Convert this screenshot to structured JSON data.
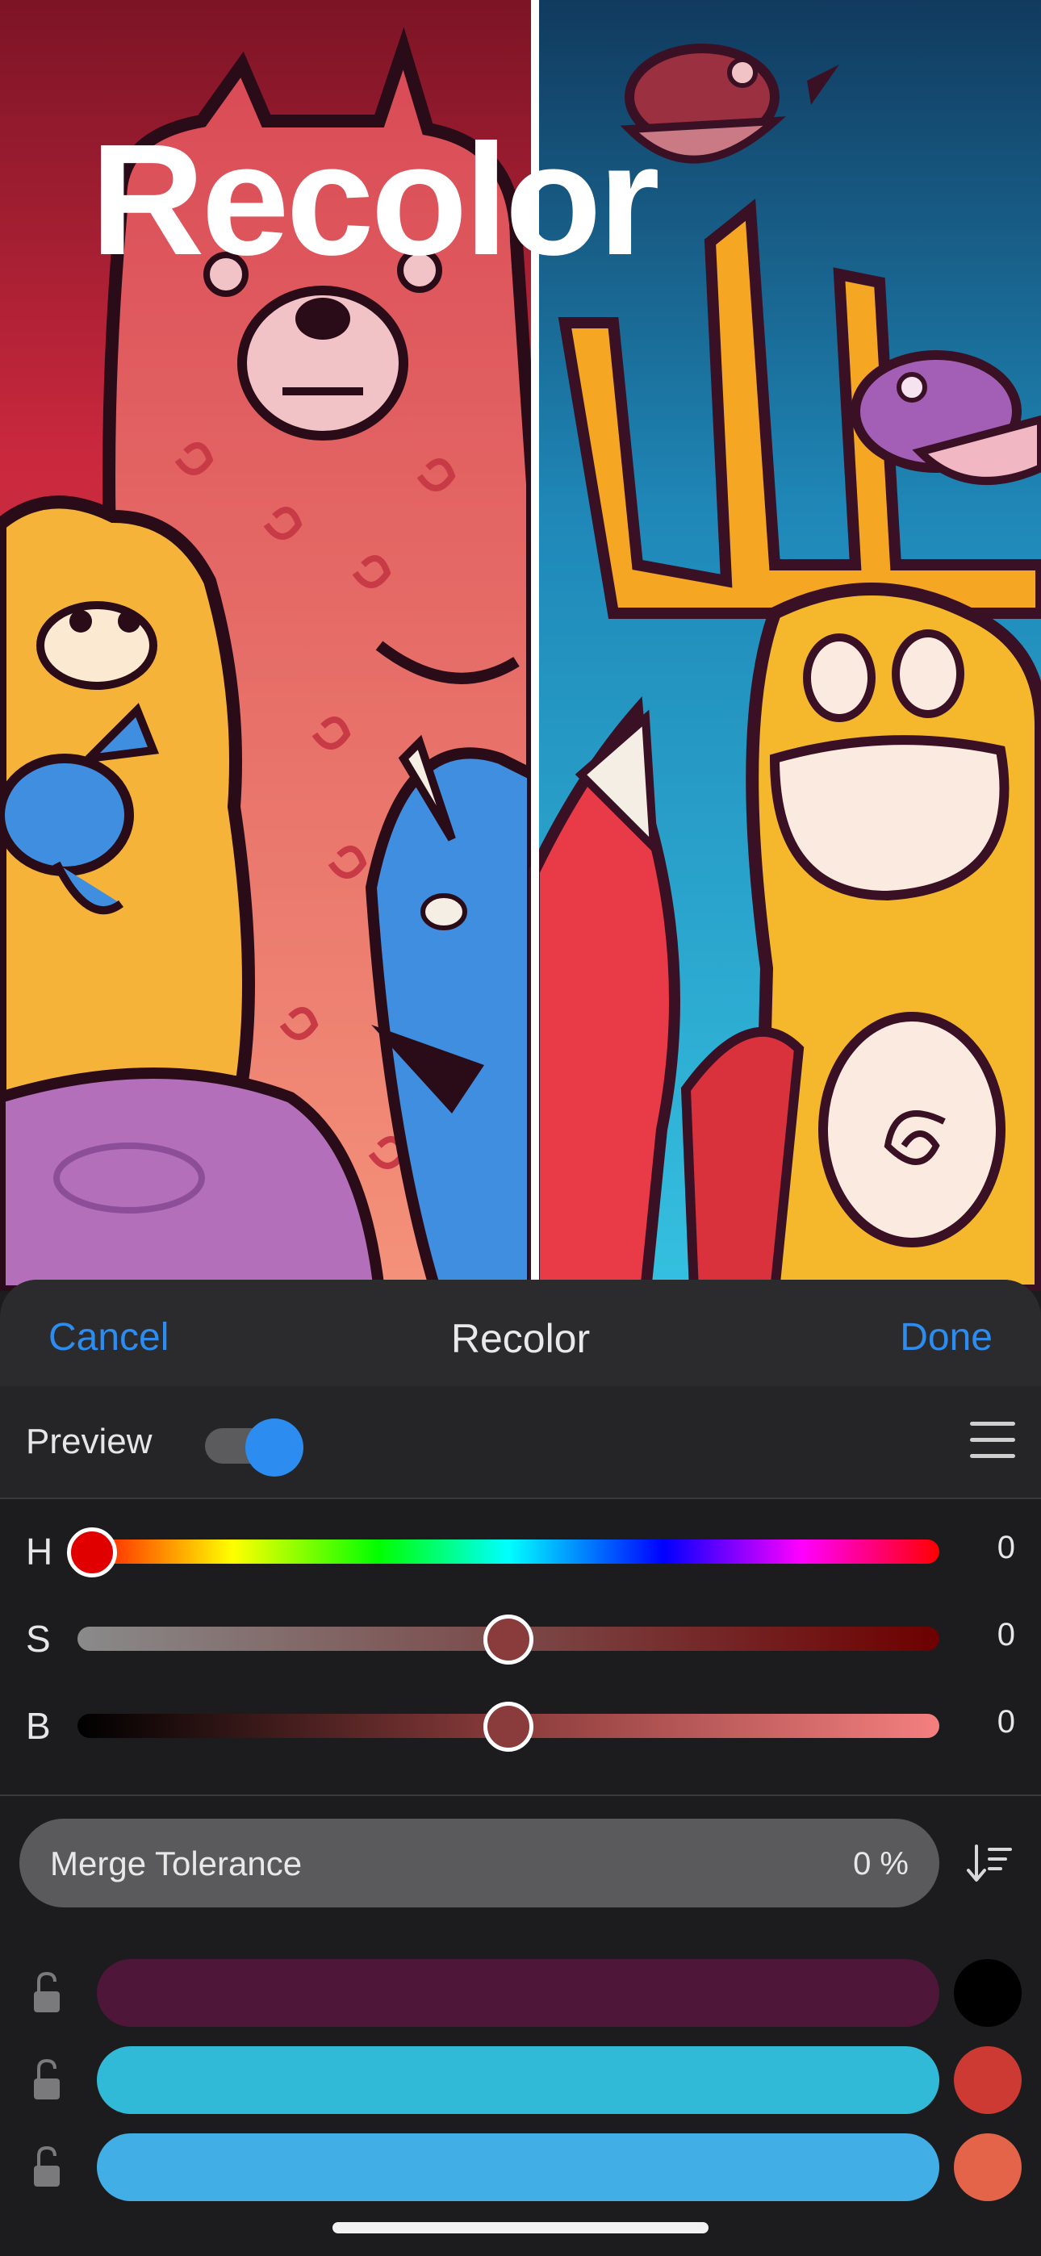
{
  "artwork": {
    "headline": "Recolor"
  },
  "navbar": {
    "cancel": "Cancel",
    "title": "Recolor",
    "done": "Done"
  },
  "preview": {
    "label": "Preview",
    "enabled": true,
    "menu_icon": "hamburger-menu-icon"
  },
  "sliders": [
    {
      "letter": "H",
      "value": "0",
      "position": 0.0
    },
    {
      "letter": "S",
      "value": "0",
      "position": 0.5
    },
    {
      "letter": "B",
      "value": "0",
      "position": 0.5
    }
  ],
  "tolerance": {
    "label": "Merge Tolerance",
    "value": "0 %",
    "sort_icon": "sort-descending-icon"
  },
  "swatches": [
    {
      "bar_color": "#4e1639",
      "dot_color": "#000000",
      "locked_icon": "lock-open-icon"
    },
    {
      "bar_color": "#31bad8",
      "dot_color": "#cd3a34",
      "locked_icon": "lock-open-icon"
    },
    {
      "bar_color": "#42aee6",
      "dot_color": "#e4644a",
      "locked_icon": "lock-open-icon"
    }
  ],
  "colors": {
    "accent": "#2d8cf0",
    "hue_thumb": "#e00000",
    "sb_thumb": "#8a3b3b"
  }
}
